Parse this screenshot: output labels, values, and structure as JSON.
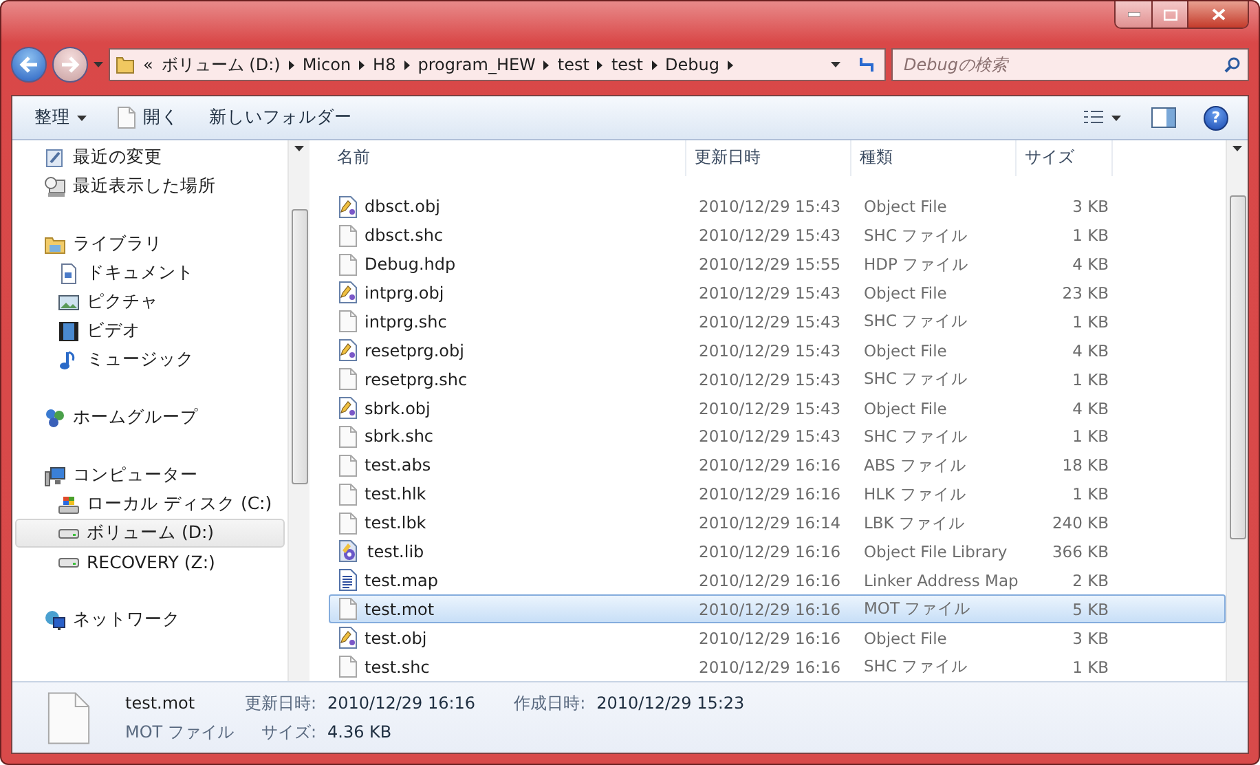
{
  "address_bar": {
    "overflow": "«",
    "crumbs": [
      "ボリューム (D:)",
      "Micon",
      "H8",
      "program_HEW",
      "test",
      "test",
      "Debug"
    ]
  },
  "search": {
    "placeholder": "Debugの検索"
  },
  "toolbar": {
    "organize": "整理",
    "open": "開く",
    "new_folder": "新しいフォルダー",
    "help": "?"
  },
  "sidebar": {
    "items": [
      {
        "label": "最近の変更",
        "kind": "recent",
        "selected": false
      },
      {
        "label": "最近表示した場所",
        "kind": "places",
        "selected": false
      },
      {
        "label": "ライブラリ",
        "kind": "library",
        "selected": false,
        "children": [
          {
            "label": "ドキュメント",
            "kind": "document",
            "selected": false
          },
          {
            "label": "ピクチャ",
            "kind": "picture",
            "selected": false
          },
          {
            "label": "ビデオ",
            "kind": "video",
            "selected": false
          },
          {
            "label": "ミュージック",
            "kind": "music",
            "selected": false
          }
        ]
      },
      {
        "label": "ホームグループ",
        "kind": "homegroup",
        "selected": false
      },
      {
        "label": "コンピューター",
        "kind": "computer",
        "selected": false,
        "children": [
          {
            "label": "ローカル ディスク (C:)",
            "kind": "sysdrive",
            "selected": false
          },
          {
            "label": "ボリューム (D:)",
            "kind": "drive",
            "selected": true
          },
          {
            "label": "RECOVERY (Z:)",
            "kind": "drive",
            "selected": false
          }
        ]
      },
      {
        "label": "ネットワーク",
        "kind": "network",
        "selected": false
      }
    ]
  },
  "table": {
    "columns": [
      "名前",
      "更新日時",
      "種類",
      "サイズ"
    ],
    "rows": [
      {
        "name": "dbsct.obj",
        "kind": "obj",
        "date": "2010/12/29 15:43",
        "type": "Object File",
        "size": "3 KB",
        "selected": false
      },
      {
        "name": "dbsct.shc",
        "kind": "blank",
        "date": "2010/12/29 15:43",
        "type": "SHC ファイル",
        "size": "1 KB",
        "selected": false
      },
      {
        "name": "Debug.hdp",
        "kind": "blank",
        "date": "2010/12/29 15:55",
        "type": "HDP ファイル",
        "size": "4 KB",
        "selected": false
      },
      {
        "name": "intprg.obj",
        "kind": "obj",
        "date": "2010/12/29 15:43",
        "type": "Object File",
        "size": "23 KB",
        "selected": false
      },
      {
        "name": "intprg.shc",
        "kind": "blank",
        "date": "2010/12/29 15:43",
        "type": "SHC ファイル",
        "size": "1 KB",
        "selected": false
      },
      {
        "name": "resetprg.obj",
        "kind": "obj",
        "date": "2010/12/29 15:43",
        "type": "Object File",
        "size": "4 KB",
        "selected": false
      },
      {
        "name": "resetprg.shc",
        "kind": "blank",
        "date": "2010/12/29 15:43",
        "type": "SHC ファイル",
        "size": "1 KB",
        "selected": false
      },
      {
        "name": "sbrk.obj",
        "kind": "obj",
        "date": "2010/12/29 15:43",
        "type": "Object File",
        "size": "4 KB",
        "selected": false
      },
      {
        "name": "sbrk.shc",
        "kind": "blank",
        "date": "2010/12/29 15:43",
        "type": "SHC ファイル",
        "size": "1 KB",
        "selected": false
      },
      {
        "name": "test.abs",
        "kind": "blank",
        "date": "2010/12/29 16:16",
        "type": "ABS ファイル",
        "size": "18 KB",
        "selected": false
      },
      {
        "name": "test.hlk",
        "kind": "blank",
        "date": "2010/12/29 16:16",
        "type": "HLK ファイル",
        "size": "1 KB",
        "selected": false
      },
      {
        "name": "test.lbk",
        "kind": "blank",
        "date": "2010/12/29 16:14",
        "type": "LBK ファイル",
        "size": "240 KB",
        "selected": false
      },
      {
        "name": "test.lib",
        "kind": "lib",
        "date": "2010/12/29 16:16",
        "type": "Object File Library",
        "size": "366 KB",
        "selected": false
      },
      {
        "name": "test.map",
        "kind": "map",
        "date": "2010/12/29 16:16",
        "type": "Linker Address Map",
        "size": "2 KB",
        "selected": false
      },
      {
        "name": "test.mot",
        "kind": "blank",
        "date": "2010/12/29 16:16",
        "type": "MOT ファイル",
        "size": "5 KB",
        "selected": true
      },
      {
        "name": "test.obj",
        "kind": "obj",
        "date": "2010/12/29 16:16",
        "type": "Object File",
        "size": "3 KB",
        "selected": false
      },
      {
        "name": "test.shc",
        "kind": "blank",
        "date": "2010/12/29 16:16",
        "type": "SHC ファイル",
        "size": "1 KB",
        "selected": false
      }
    ]
  },
  "details": {
    "name": "test.mot",
    "type": "MOT ファイル",
    "fields": [
      {
        "label": "更新日時:",
        "value": "2010/12/29 16:16"
      },
      {
        "label": "作成日時:",
        "value": "2010/12/29 15:23"
      },
      {
        "label": "サイズ:",
        "value": "4.36 KB"
      }
    ]
  }
}
